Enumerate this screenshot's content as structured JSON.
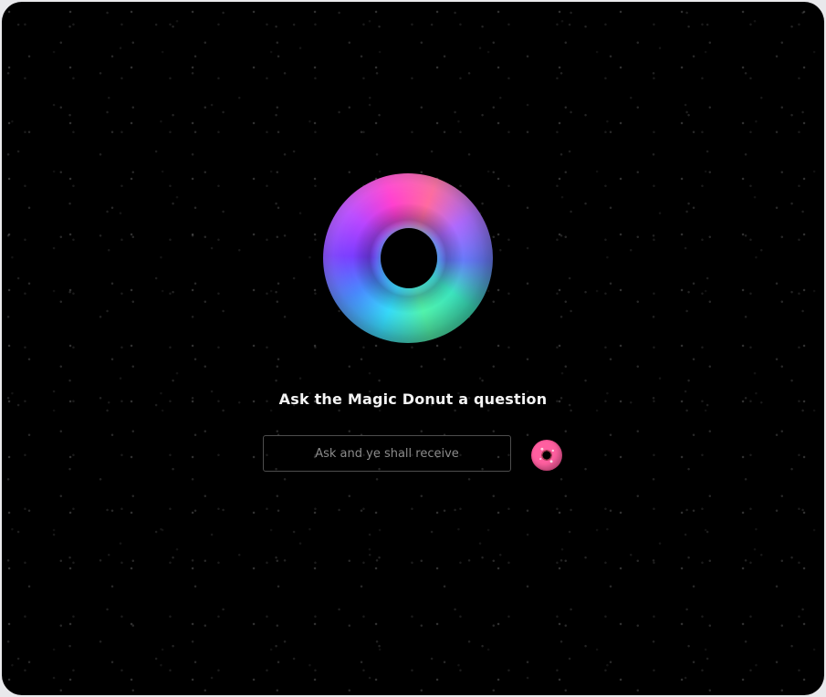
{
  "prompt": {
    "title": "Ask the Magic Donut a question"
  },
  "input": {
    "placeholder": "Ask and ye shall receive",
    "value": ""
  },
  "icons": {
    "hero": "magic-donut-icon",
    "submit": "donut-icon"
  },
  "colors": {
    "background": "#000000",
    "text": "#f4f4f4",
    "placeholder": "#8b8b8b",
    "input_border": "#4d4d4d"
  }
}
